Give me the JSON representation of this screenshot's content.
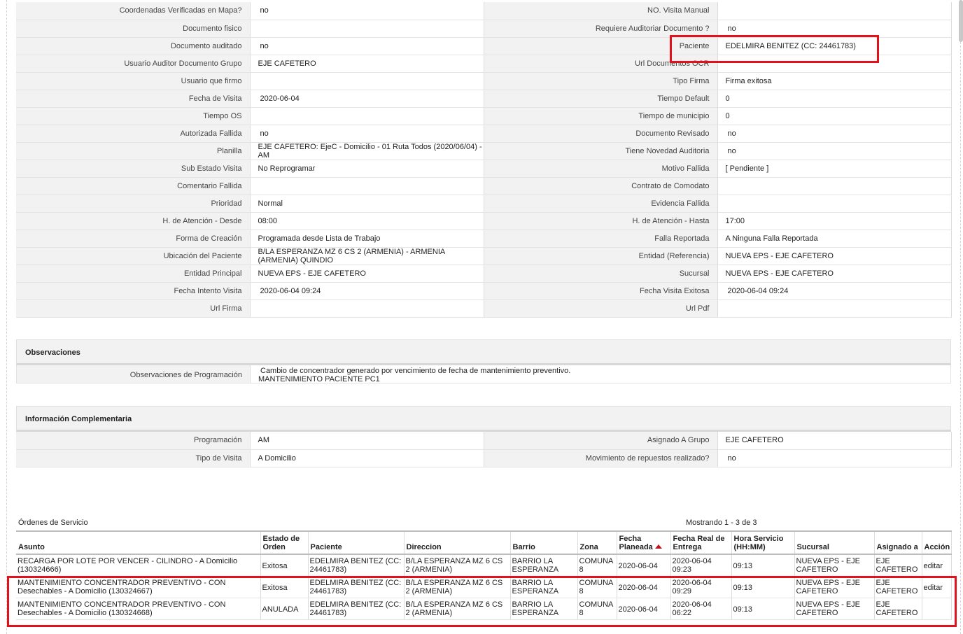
{
  "details": {
    "rows": [
      [
        {
          "label": "Coordenadas Verificadas en Mapa?",
          "value": "no"
        },
        {
          "label": "NO. Visita Manual",
          "value": ""
        }
      ],
      [
        {
          "label": "Documento fisico",
          "value": ""
        },
        {
          "label": "Requiere Auditoriar Documento ?",
          "value": "no"
        }
      ],
      [
        {
          "label": "Documento auditado",
          "value": "no"
        },
        {
          "label": "Paciente",
          "value": "EDELMIRA BENITEZ (CC: 24461783)"
        }
      ],
      [
        {
          "label": "Usuario Auditor Documento Grupo",
          "value": "EJE CAFETERO"
        },
        {
          "label": "Url Documentos OCR",
          "value": ""
        }
      ],
      [
        {
          "label": "Usuario que firmo",
          "value": ""
        },
        {
          "label": "Tipo Firma",
          "value": "Firma exitosa"
        }
      ],
      [
        {
          "label": "Fecha de Visita",
          "value": "2020-06-04"
        },
        {
          "label": "Tiempo Default",
          "value": "0"
        }
      ],
      [
        {
          "label": "Tiempo OS",
          "value": ""
        },
        {
          "label": "Tiempo de municipio",
          "value": "0"
        }
      ],
      [
        {
          "label": "Autorizada Fallida",
          "value": "no"
        },
        {
          "label": "Documento Revisado",
          "value": "no"
        }
      ],
      [
        {
          "label": "Planilla",
          "value": "EJE CAFETERO: EjeC - Domicilio - 01 Ruta Todos (2020/06/04) - AM"
        },
        {
          "label": "Tiene Novedad Auditoria",
          "value": "no"
        }
      ],
      [
        {
          "label": "Sub Estado Visita",
          "value": "No Reprogramar"
        },
        {
          "label": "Motivo Fallida",
          "value": "[ Pendiente ]"
        }
      ],
      [
        {
          "label": "Comentario Fallida",
          "value": ""
        },
        {
          "label": "Contrato de Comodato",
          "value": ""
        }
      ],
      [
        {
          "label": "Prioridad",
          "value": "Normal"
        },
        {
          "label": "Evidencia Fallida",
          "value": ""
        }
      ],
      [
        {
          "label": "H. de Atención - Desde",
          "value": "08:00"
        },
        {
          "label": "H. de Atención - Hasta",
          "value": "17:00"
        }
      ],
      [
        {
          "label": "Forma de Creación",
          "value": "Programada desde Lista de Trabajo"
        },
        {
          "label": "Falla Reportada",
          "value": "A Ninguna Falla Reportada"
        }
      ],
      [
        {
          "label": "Ubicación del Paciente",
          "value": "B/LA ESPERANZA MZ 6 CS 2 (ARMENIA) - ARMENIA (ARMENIA) QUINDIO"
        },
        {
          "label": "Entidad (Referencia)",
          "value": "NUEVA EPS - EJE CAFETERO"
        }
      ],
      [
        {
          "label": "Entidad Principal",
          "value": "NUEVA EPS - EJE CAFETERO"
        },
        {
          "label": "Sucursal",
          "value": "NUEVA EPS - EJE CAFETERO"
        }
      ],
      [
        {
          "label": "Fecha Intento Visita",
          "value": "2020-06-04 09:24"
        },
        {
          "label": "Fecha Visita Exitosa",
          "value": "2020-06-04 09:24"
        }
      ],
      [
        {
          "label": "Url Firma",
          "value": ""
        },
        {
          "label": "Url Pdf",
          "value": ""
        }
      ]
    ]
  },
  "observaciones": {
    "title": "Observaciones",
    "label": "Observaciones de Programación",
    "line1": "Cambio de concentrador generado por vencimiento de fecha de mantenimiento preventivo.",
    "line2": "MANTENIMIENTO PACIENTE PC1"
  },
  "complementaria": {
    "title": "Información Complementaria",
    "rows": [
      [
        {
          "label": "Programación",
          "value": "AM"
        },
        {
          "label": "Asignado A Grupo",
          "value": "EJE CAFETERO"
        }
      ],
      [
        {
          "label": "Tipo de Visita",
          "value": "A Domicilio"
        },
        {
          "label": "Movimiento de repuestos realizado?",
          "value": "no"
        }
      ]
    ]
  },
  "ordenes": {
    "title": "Órdenes de Servicio",
    "count": "Mostrando 1 - 3 de 3",
    "headers": {
      "asunto": "Asunto",
      "estado": "Estado de Orden",
      "paciente": "Paciente",
      "direccion": "Direccion",
      "barrio": "Barrio",
      "zona": "Zona",
      "fecha_planeada": "Fecha Planeada",
      "fecha_real": "Fecha Real de Entrega",
      "hora": "Hora Servicio (HH:MM)",
      "sucursal": "Sucursal",
      "asignado": "Asignado a",
      "accion": "Acción"
    },
    "rows": [
      {
        "asunto": "RECARGA POR LOTE POR VENCER - CILINDRO - A Domicilio (130324666)",
        "estado": "Exitosa",
        "paciente": "EDELMIRA BENITEZ (CC: 24461783)",
        "direccion": "B/LA ESPERANZA MZ 6 CS 2 (ARMENIA)",
        "barrio": "BARRIO LA ESPERANZA",
        "zona": "COMUNA 8",
        "fecha_planeada": "2020-06-04",
        "fecha_real": "2020-06-04 09:23",
        "hora": "09:13",
        "sucursal": "NUEVA EPS - EJE CAFETERO",
        "asignado": "EJE CAFETERO",
        "accion": "editar"
      },
      {
        "asunto": "MANTENIMIENTO CONCENTRADOR PREVENTIVO - CON Desechables - A Domicilio (130324667)",
        "estado": "Exitosa",
        "paciente": "EDELMIRA BENITEZ (CC: 24461783)",
        "direccion": "B/LA ESPERANZA MZ 6 CS 2 (ARMENIA)",
        "barrio": "BARRIO LA ESPERANZA",
        "zona": "COMUNA 8",
        "fecha_planeada": "2020-06-04",
        "fecha_real": "2020-06-04 09:29",
        "hora": "09:13",
        "sucursal": "NUEVA EPS - EJE CAFETERO",
        "asignado": "EJE CAFETERO",
        "accion": "editar"
      },
      {
        "asunto": "MANTENIMIENTO CONCENTRADOR PREVENTIVO - CON Desechables - A Domicilio (130324668)",
        "estado": "ANULADA",
        "paciente": "EDELMIRA BENITEZ (CC: 24461783)",
        "direccion": "B/LA ESPERANZA MZ 6 CS 2 (ARMENIA)",
        "barrio": "BARRIO LA ESPERANZA",
        "zona": "COMUNA 8",
        "fecha_planeada": "2020-06-04",
        "fecha_real": "2020-06-04 06:22",
        "hora": "09:13",
        "sucursal": "NUEVA EPS - EJE CAFETERO",
        "asignado": "EJE CAFETERO",
        "accion": ""
      }
    ]
  },
  "colors": {
    "highlight": "#e0121c",
    "label_bg": "#f2f2f2"
  }
}
